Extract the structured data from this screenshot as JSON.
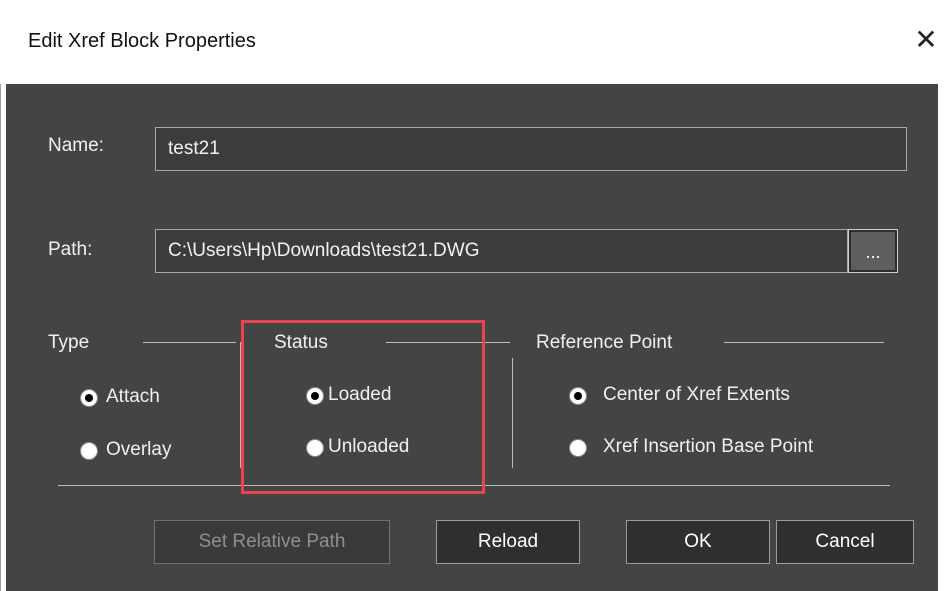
{
  "window": {
    "title": "Edit Xref Block Properties",
    "close_glyph": "✕"
  },
  "name_field": {
    "label": "Name:",
    "value": "test21"
  },
  "path_field": {
    "label": "Path:",
    "value": "C:\\Users\\Hp\\Downloads\\test21.DWG",
    "browse_label": "..."
  },
  "type_group": {
    "label": "Type",
    "options": [
      {
        "label": "Attach",
        "selected": true
      },
      {
        "label": "Overlay",
        "selected": false
      }
    ]
  },
  "status_group": {
    "label": "Status",
    "options": [
      {
        "label": "Loaded",
        "selected": true
      },
      {
        "label": "Unloaded",
        "selected": false
      }
    ]
  },
  "reference_group": {
    "label": "Reference Point",
    "options": [
      {
        "label": "Center of Xref Extents",
        "selected": true
      },
      {
        "label": "Xref Insertion Base Point",
        "selected": false
      }
    ]
  },
  "buttons": {
    "set_relative_path": "Set Relative Path",
    "reload": "Reload",
    "ok": "OK",
    "cancel": "Cancel"
  },
  "colors": {
    "dialog_bg": "#444444",
    "highlight": "#e8444a"
  }
}
